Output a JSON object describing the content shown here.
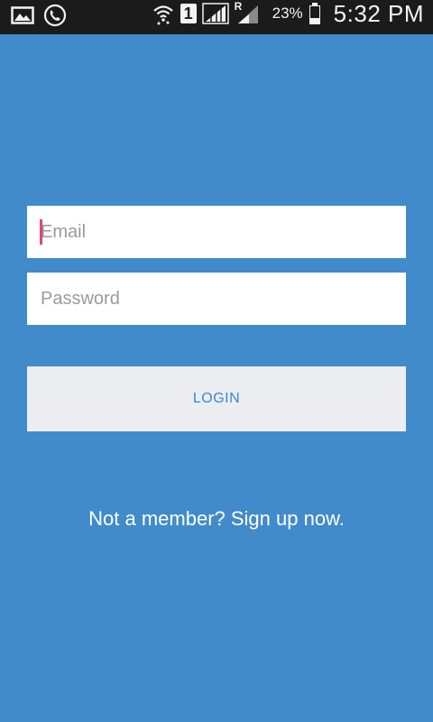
{
  "status_bar": {
    "battery_percent": "23%",
    "time": "5:32 PM",
    "sim_slot": "1",
    "roaming_indicator": "R",
    "icons": [
      "gallery-icon",
      "call-icon",
      "wifi-icon",
      "sim-1-icon",
      "signal-icon",
      "roaming-signal-icon",
      "battery-icon"
    ]
  },
  "login_form": {
    "email_placeholder": "Email",
    "email_value": "",
    "password_placeholder": "Password",
    "password_value": "",
    "login_label": "LOGIN",
    "signup_text": "Not a member? Sign up now."
  },
  "colors": {
    "background": "#418bca",
    "status_bar": "#1b1b1b",
    "button_bg": "#ebedf1",
    "button_text": "#3d88c6",
    "cursor": "#e0457b"
  }
}
